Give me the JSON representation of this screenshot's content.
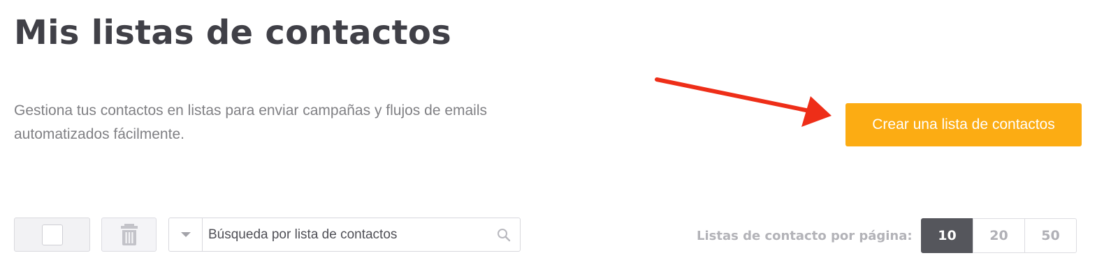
{
  "header": {
    "title": "Mis listas de contactos"
  },
  "intro": {
    "description": "Gestiona tus contactos en listas para enviar campañas y flujos de emails automatizados fácilmente."
  },
  "actions": {
    "create_list_label": "Crear una lista de contactos"
  },
  "toolbar": {
    "select_all_checked": false,
    "delete_icon": "trash-icon",
    "filter_icon": "caret-down-icon",
    "search": {
      "value": "",
      "placeholder": "Búsqueda por lista de contactos",
      "icon": "search-icon"
    }
  },
  "pagination": {
    "per_page_label": "Listas de contacto por página:",
    "options": [
      "10",
      "20",
      "50"
    ],
    "selected": "10"
  },
  "annotation": {
    "arrow_color": "#ee2e18",
    "target": "create-list-button"
  },
  "colors": {
    "accent": "#fcac13",
    "title": "#404047",
    "active_option": "#55565c"
  }
}
